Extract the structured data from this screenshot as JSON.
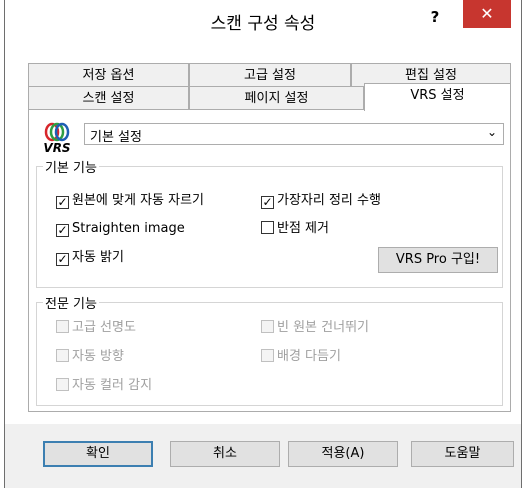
{
  "window": {
    "title": "스캔 구성 속성",
    "help_label": "?",
    "close_label": "✕"
  },
  "tabs_back": [
    "저장 옵션",
    "고급 설정",
    "편집 설정"
  ],
  "tabs_front": [
    "스캔 설정",
    "페이지 설정",
    "VRS 설정"
  ],
  "active_tab": "VRS 설정",
  "vrs": {
    "logo_text": "VRS",
    "profile_select": "기본 설정"
  },
  "basic": {
    "legend": "기본 기능",
    "items": [
      {
        "label": "원본에 맞게 자동 자르기",
        "checked": true
      },
      {
        "label": "가장자리 정리 수행",
        "checked": true
      },
      {
        "label": "Straighten image",
        "checked": true
      },
      {
        "label": "반점 제거",
        "checked": false
      },
      {
        "label": "자동 밝기",
        "checked": true
      }
    ],
    "buy_button": "VRS Pro 구입!"
  },
  "pro": {
    "legend": "전문 기능",
    "items": [
      {
        "label": "고급 선명도",
        "checked": false,
        "disabled": true
      },
      {
        "label": "빈 원본 건너뛰기",
        "checked": false,
        "disabled": true
      },
      {
        "label": "자동 방향",
        "checked": false,
        "disabled": true
      },
      {
        "label": "배경 다듬기",
        "checked": false,
        "disabled": true
      },
      {
        "label": "자동 컬러 감지",
        "checked": false,
        "disabled": true
      }
    ]
  },
  "buttons": {
    "ok": "확인",
    "cancel": "취소",
    "apply": "적용(A)",
    "help": "도움말"
  },
  "colors": {
    "close_button": "#c7362f",
    "default_button_border": "#3c7fb1",
    "logo_red": "#d7262b",
    "logo_green": "#2f9e44",
    "logo_blue": "#1e5fb4"
  }
}
